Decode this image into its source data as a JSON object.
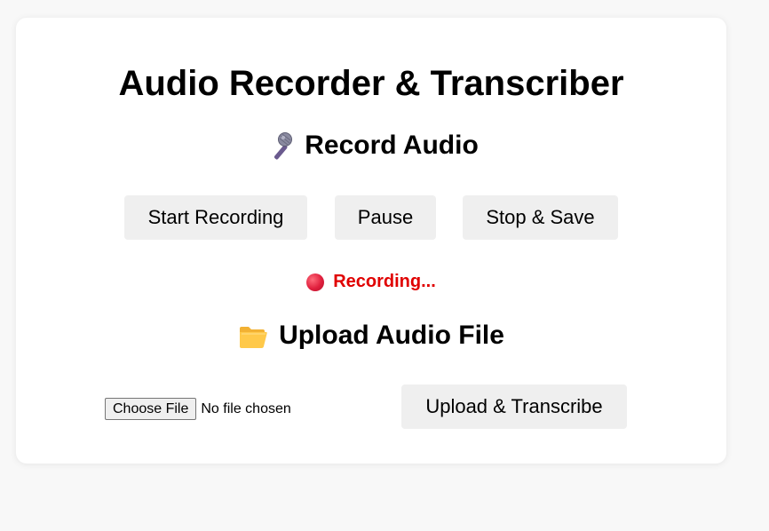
{
  "page": {
    "title": "Audio Recorder & Transcriber"
  },
  "record": {
    "heading": "Record Audio",
    "icon": "microphone-icon",
    "start_label": "Start Recording",
    "pause_label": "Pause",
    "stop_label": "Stop & Save",
    "status_text": "Recording...",
    "status_icon": "red-circle-icon",
    "status_color": "#e00000"
  },
  "upload": {
    "heading": "Upload Audio File",
    "icon": "folder-icon",
    "choose_file_label": "Choose File",
    "file_status": "No file chosen",
    "upload_label": "Upload & Transcribe"
  }
}
